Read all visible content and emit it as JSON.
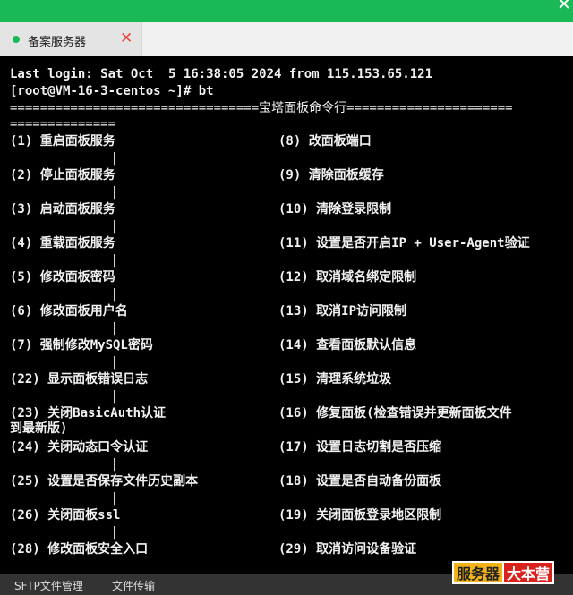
{
  "window": {
    "close_glyph": "✕"
  },
  "tab": {
    "label": "备案服务器",
    "close_glyph": "✕"
  },
  "terminal": {
    "last_login": "Last login: Sat Oct  5 16:38:05 2024 from 115.153.65.121",
    "prompt_line": "[root@VM-16-3-centos ~]# bt",
    "banner_line1": "=================================宝塔面板命令行======================",
    "banner_line2": "==============",
    "separator_glyph": "|",
    "rows": [
      {
        "left": "(1) 重启面板服务",
        "right": "(8) 改面板端口"
      },
      {
        "left": "(2) 停止面板服务",
        "right": "(9) 清除面板缓存"
      },
      {
        "left": "(3) 启动面板服务",
        "right": "(10) 清除登录限制"
      },
      {
        "left": "(4) 重载面板服务",
        "right": "(11) 设置是否开启IP + User-Agent验证"
      },
      {
        "left": "(5) 修改面板密码",
        "right": "(12) 取消域名绑定限制"
      },
      {
        "left": "(6) 修改面板用户名",
        "right": "(13) 取消IP访问限制"
      },
      {
        "left": "(7) 强制修改MySQL密码",
        "right": "(14) 查看面板默认信息"
      },
      {
        "left": "(22) 显示面板错误日志",
        "right": "(15) 清理系统垃圾"
      },
      {
        "left": "(23) 关闭BasicAuth认证",
        "right": "(16) 修复面板(检查错误并更新面板文件",
        "wrap": "到最新版)"
      },
      {
        "left": "(24) 关闭动态口令认证",
        "right": "(17) 设置日志切割是否压缩"
      },
      {
        "left": "(25) 设置是否保存文件历史副本",
        "right": "(18) 设置是否自动备份面板"
      },
      {
        "left": "(26) 关闭面板ssl",
        "right": "(19) 关闭面板登录地区限制"
      },
      {
        "left": "(28) 修改面板安全入口",
        "right": "(29) 取消访问设备验证"
      }
    ]
  },
  "statusbar": {
    "sftp_label": "SFTP文件管理",
    "transfer_label": "文件传输"
  },
  "watermark": {
    "part1": "服务器",
    "part2": "大本营"
  }
}
